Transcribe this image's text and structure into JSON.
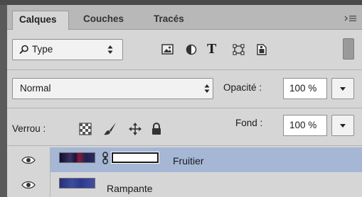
{
  "tabs": [
    {
      "label": "Calques",
      "active": true
    },
    {
      "label": "Couches",
      "active": false
    },
    {
      "label": "Tracés",
      "active": false
    }
  ],
  "filter": {
    "label": "Type"
  },
  "blend": {
    "mode": "Normal"
  },
  "opacity": {
    "label": "Opacité :",
    "value": "100 %"
  },
  "lock": {
    "label": "Verrou :"
  },
  "fill": {
    "label": "Fond :",
    "value": "100 %"
  },
  "layers": [
    {
      "name": "Fruitier",
      "selected": true,
      "visible": true
    },
    {
      "name": "Rampante",
      "selected": false,
      "visible": true
    }
  ],
  "colors": {
    "selection": "#a6b7d6",
    "panel": "#d6d6d6",
    "tabbar": "#b8b8b8"
  }
}
